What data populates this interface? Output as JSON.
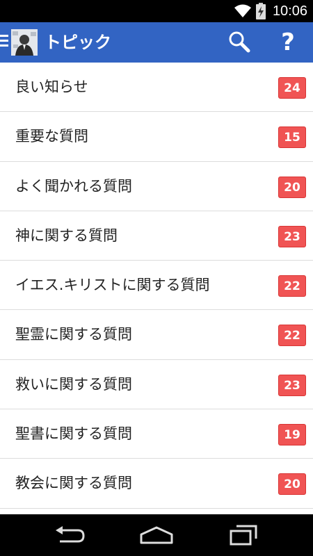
{
  "status_bar": {
    "time": "10:06",
    "icons": [
      "wifi-icon",
      "battery-charging-icon"
    ]
  },
  "action_bar": {
    "title": "トピック",
    "icons": [
      "drawer-menu-icon",
      "app-avatar",
      "search-icon",
      "help-icon"
    ],
    "help_glyph": "?"
  },
  "topics": [
    {
      "label": "良い知らせ",
      "count": "24"
    },
    {
      "label": "重要な質問",
      "count": "15"
    },
    {
      "label": "よく聞かれる質問",
      "count": "20"
    },
    {
      "label": "神に関する質問",
      "count": "23"
    },
    {
      "label": "イエス.キリストに関する質問",
      "count": "22"
    },
    {
      "label": "聖霊に関する質問",
      "count": "22"
    },
    {
      "label": "救いに関する質問",
      "count": "23"
    },
    {
      "label": "聖書に関する質問",
      "count": "19"
    },
    {
      "label": "教会に関する質問",
      "count": "20"
    }
  ],
  "nav_bar": {
    "icons": [
      "back-icon",
      "home-icon",
      "recents-icon"
    ]
  },
  "colors": {
    "action_bar": "#3264c3",
    "badge": "#f05454",
    "badge_border": "#d83434"
  }
}
